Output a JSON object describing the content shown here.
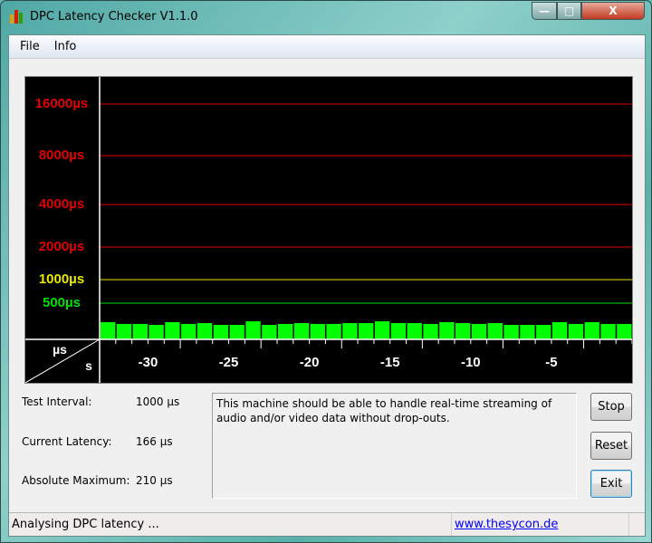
{
  "window": {
    "title": "DPC Latency Checker V1.1.0",
    "controls": {
      "minimize": "—",
      "maximize": "□",
      "close": "X"
    }
  },
  "menu": [
    "File",
    "Info"
  ],
  "chart_data": {
    "type": "bar",
    "y_scale": "nonlinear",
    "y_ticks": [
      {
        "label": "16000µs",
        "value": 16000,
        "color": "#e00000"
      },
      {
        "label": "8000µs",
        "value": 8000,
        "color": "#e00000"
      },
      {
        "label": "4000µs",
        "value": 4000,
        "color": "#e00000"
      },
      {
        "label": "2000µs",
        "value": 2000,
        "color": "#e00000"
      },
      {
        "label": "1000µs",
        "value": 1000,
        "color": "#e8e800"
      },
      {
        "label": "500µs",
        "value": 500,
        "color": "#00e000"
      }
    ],
    "x_ticks": [
      -30,
      -25,
      -20,
      -15,
      -10,
      -5
    ],
    "ylabel": "µs",
    "xlabel": "s",
    "bar_color": "#00ff00",
    "values": [
      200,
      179,
      179,
      168,
      200,
      179,
      189,
      168,
      168,
      210,
      168,
      179,
      189,
      179,
      179,
      189,
      189,
      210,
      189,
      189,
      179,
      200,
      189,
      179,
      189,
      168,
      168,
      168,
      200,
      179,
      200,
      179,
      179
    ]
  },
  "stats": {
    "test_interval_label": "Test Interval:",
    "test_interval": "1000 µs",
    "current_label": "Current Latency:",
    "current": "166 µs",
    "max_label": "Absolute Maximum:",
    "max": "210 µs"
  },
  "message": "This machine should be able to handle real-time streaming of audio and/or video data without drop-outs.",
  "buttons": {
    "stop": "Stop",
    "reset": "Reset",
    "exit": "Exit"
  },
  "status": {
    "text": "Analysing DPC latency ...",
    "link": "www.thesycon.de"
  }
}
